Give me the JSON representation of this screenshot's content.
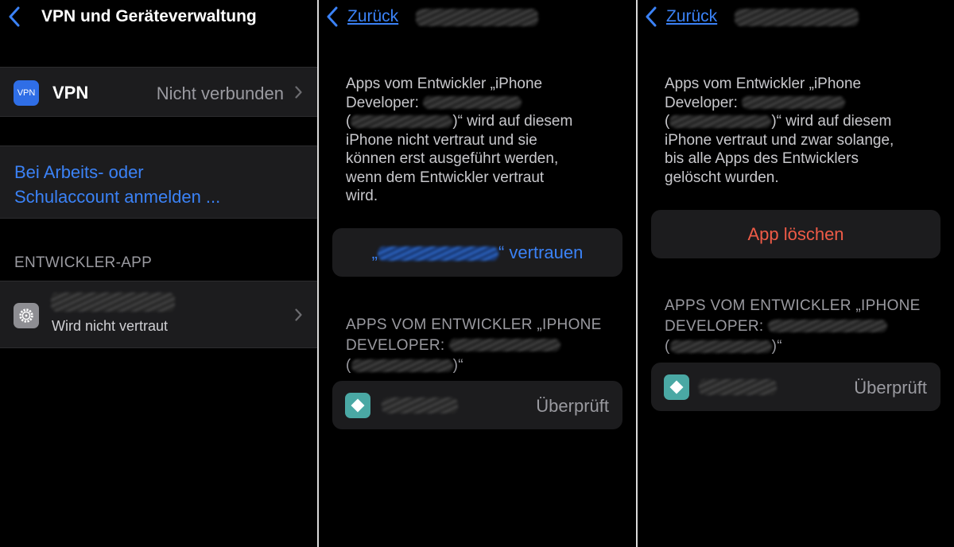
{
  "panel1": {
    "title": "VPN und Geräteverwaltung",
    "vpn": {
      "icon_text": "VPN",
      "label": "VPN",
      "value": "Nicht verbunden"
    },
    "signin": {
      "line1": "Bei Arbeits- oder",
      "line2": "Schulaccount anmelden ..."
    },
    "developer_section": {
      "header": "ENTWICKLER-APP",
      "subtitle": "Wird nicht vertraut"
    }
  },
  "panel2": {
    "back_label": "Zurück",
    "description": {
      "line1": "Apps vom Entwickler „iPhone",
      "line2": "Developer:",
      "line3_open": "(",
      "line3_close": ")“ wird auf diesem",
      "line4": "iPhone nicht vertraut und sie",
      "line5": "können erst ausgeführt werden,",
      "line6": "wenn dem Entwickler vertraut",
      "line7": "wird."
    },
    "trust_button": {
      "prefix": "„",
      "suffix": "“ vertrauen"
    },
    "apps_header": {
      "line1": "APPS VOM ENTWICKLER „IPHONE",
      "line2": "DEVELOPER:",
      "line3_open": "(",
      "line3_close": ")“"
    },
    "app_status": "Überprüft"
  },
  "panel3": {
    "back_label": "Zurück",
    "description": {
      "line1": "Apps vom Entwickler „iPhone",
      "line2": "Developer:",
      "line3_open": "(",
      "line3_close": ")“ wird auf diesem",
      "line4": "iPhone vertraut und zwar solange,",
      "line5": "bis alle Apps des Entwicklers",
      "line6": "gelöscht wurden."
    },
    "delete_button": "App löschen",
    "apps_header": {
      "line1": "APPS VOM ENTWICKLER „IPHONE",
      "line2": "DEVELOPER:",
      "line3_open": "(",
      "line3_close": ")“"
    },
    "app_status": "Überprüft"
  },
  "colors": {
    "accent": "#3b82f6",
    "destructive": "#ef5b47",
    "cell_bg": "#1c1c1e",
    "secondary_text": "#9a9aa0"
  },
  "icons": [
    "chevron-left-icon",
    "chevron-right-icon",
    "vpn-icon",
    "gear-icon",
    "app-icon"
  ]
}
